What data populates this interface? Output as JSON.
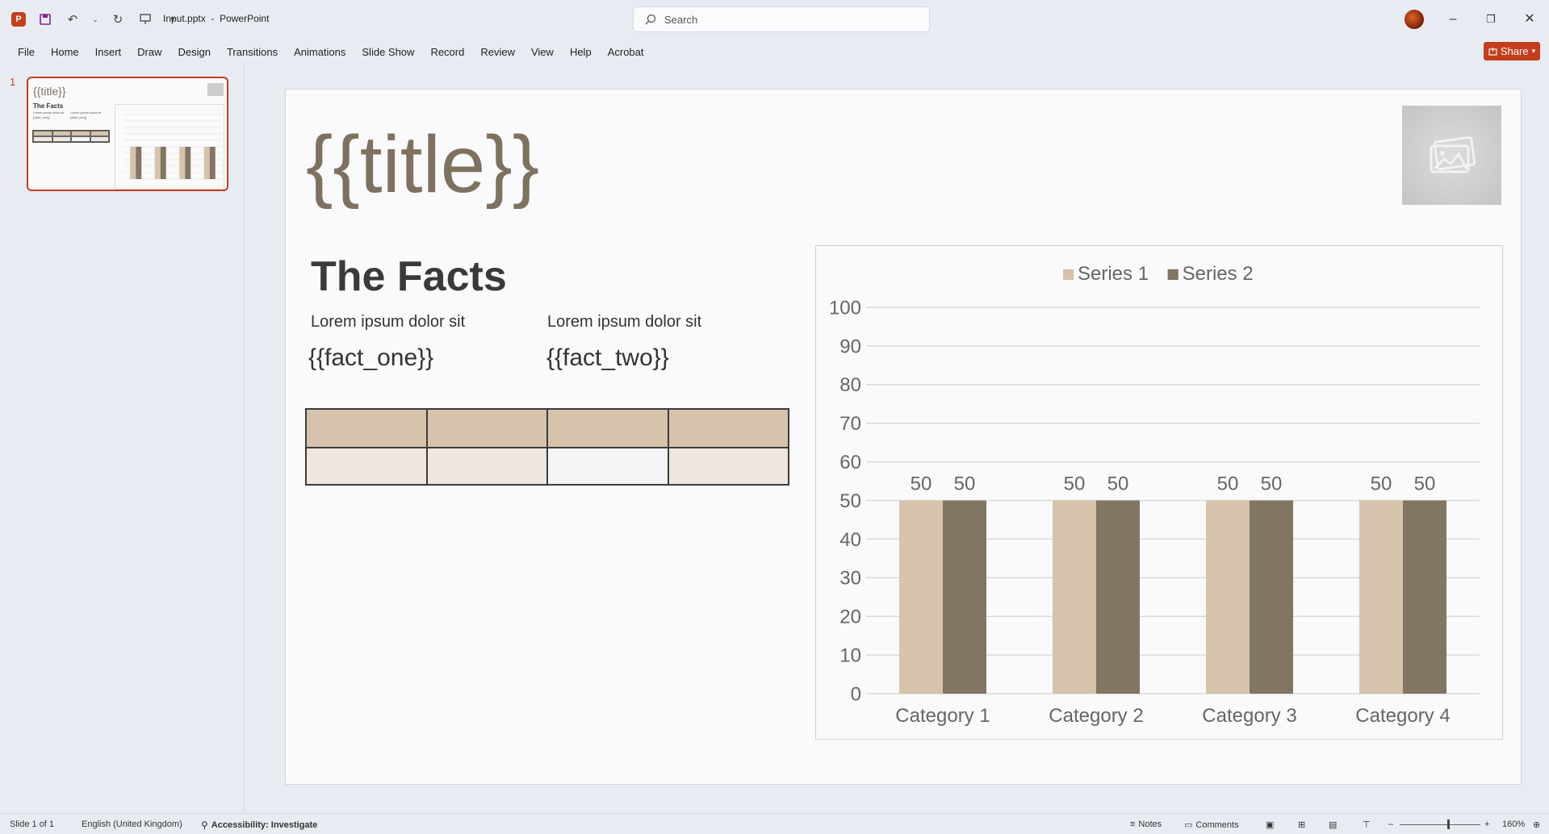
{
  "app": {
    "document_title": "Input.pptx",
    "separator": "-",
    "app_name": "PowerPoint",
    "search_placeholder": "Search",
    "share_label": "Share"
  },
  "menu": [
    "File",
    "Home",
    "Insert",
    "Draw",
    "Design",
    "Transitions",
    "Animations",
    "Slide Show",
    "Record",
    "Review",
    "View",
    "Help",
    "Acrobat"
  ],
  "thumbnail": {
    "number": "1",
    "title": "{{title}}",
    "facts": "The Facts",
    "lorem1": "Lorem ipsum dolor sit",
    "lorem2": "Lorem ipsum dolor sit",
    "fact_one": "{{fact_one}}",
    "fact_two": "{{fact_two}}"
  },
  "slide": {
    "title": "{{title}}",
    "heading": "The Facts",
    "lorem1": "Lorem ipsum dolor sit",
    "lorem2": "Lorem ipsum dolor sit",
    "fact_one": "{{fact_one}}",
    "fact_two": "{{fact_two}}",
    "table_colors": {
      "header": "#d5c3ac",
      "row": [
        "#efe7df",
        "#efe7df",
        "#f4f4f4",
        "#efe7df"
      ]
    }
  },
  "chart_data": {
    "type": "bar",
    "categories": [
      "Category 1",
      "Category 2",
      "Category 3",
      "Category 4"
    ],
    "series": [
      {
        "name": "Series 1",
        "values": [
          50,
          50,
          50,
          50
        ],
        "color": "#d5c3ac"
      },
      {
        "name": "Series 2",
        "values": [
          50,
          50,
          50,
          50
        ],
        "color": "#827563"
      }
    ],
    "ylim": [
      0,
      100
    ],
    "yticks": [
      0,
      10,
      20,
      30,
      40,
      50,
      60,
      70,
      80,
      90,
      100
    ],
    "grid": true,
    "legend": "top",
    "data_labels": true
  },
  "status": {
    "slide_info": "Slide 1 of 1",
    "language": "English (United Kingdom)",
    "accessibility": "Accessibility: Investigate",
    "notes": "Notes",
    "comments": "Comments",
    "zoom": "160%"
  },
  "colors": {
    "accent": "#c43e1c",
    "title": "#7f7160"
  }
}
